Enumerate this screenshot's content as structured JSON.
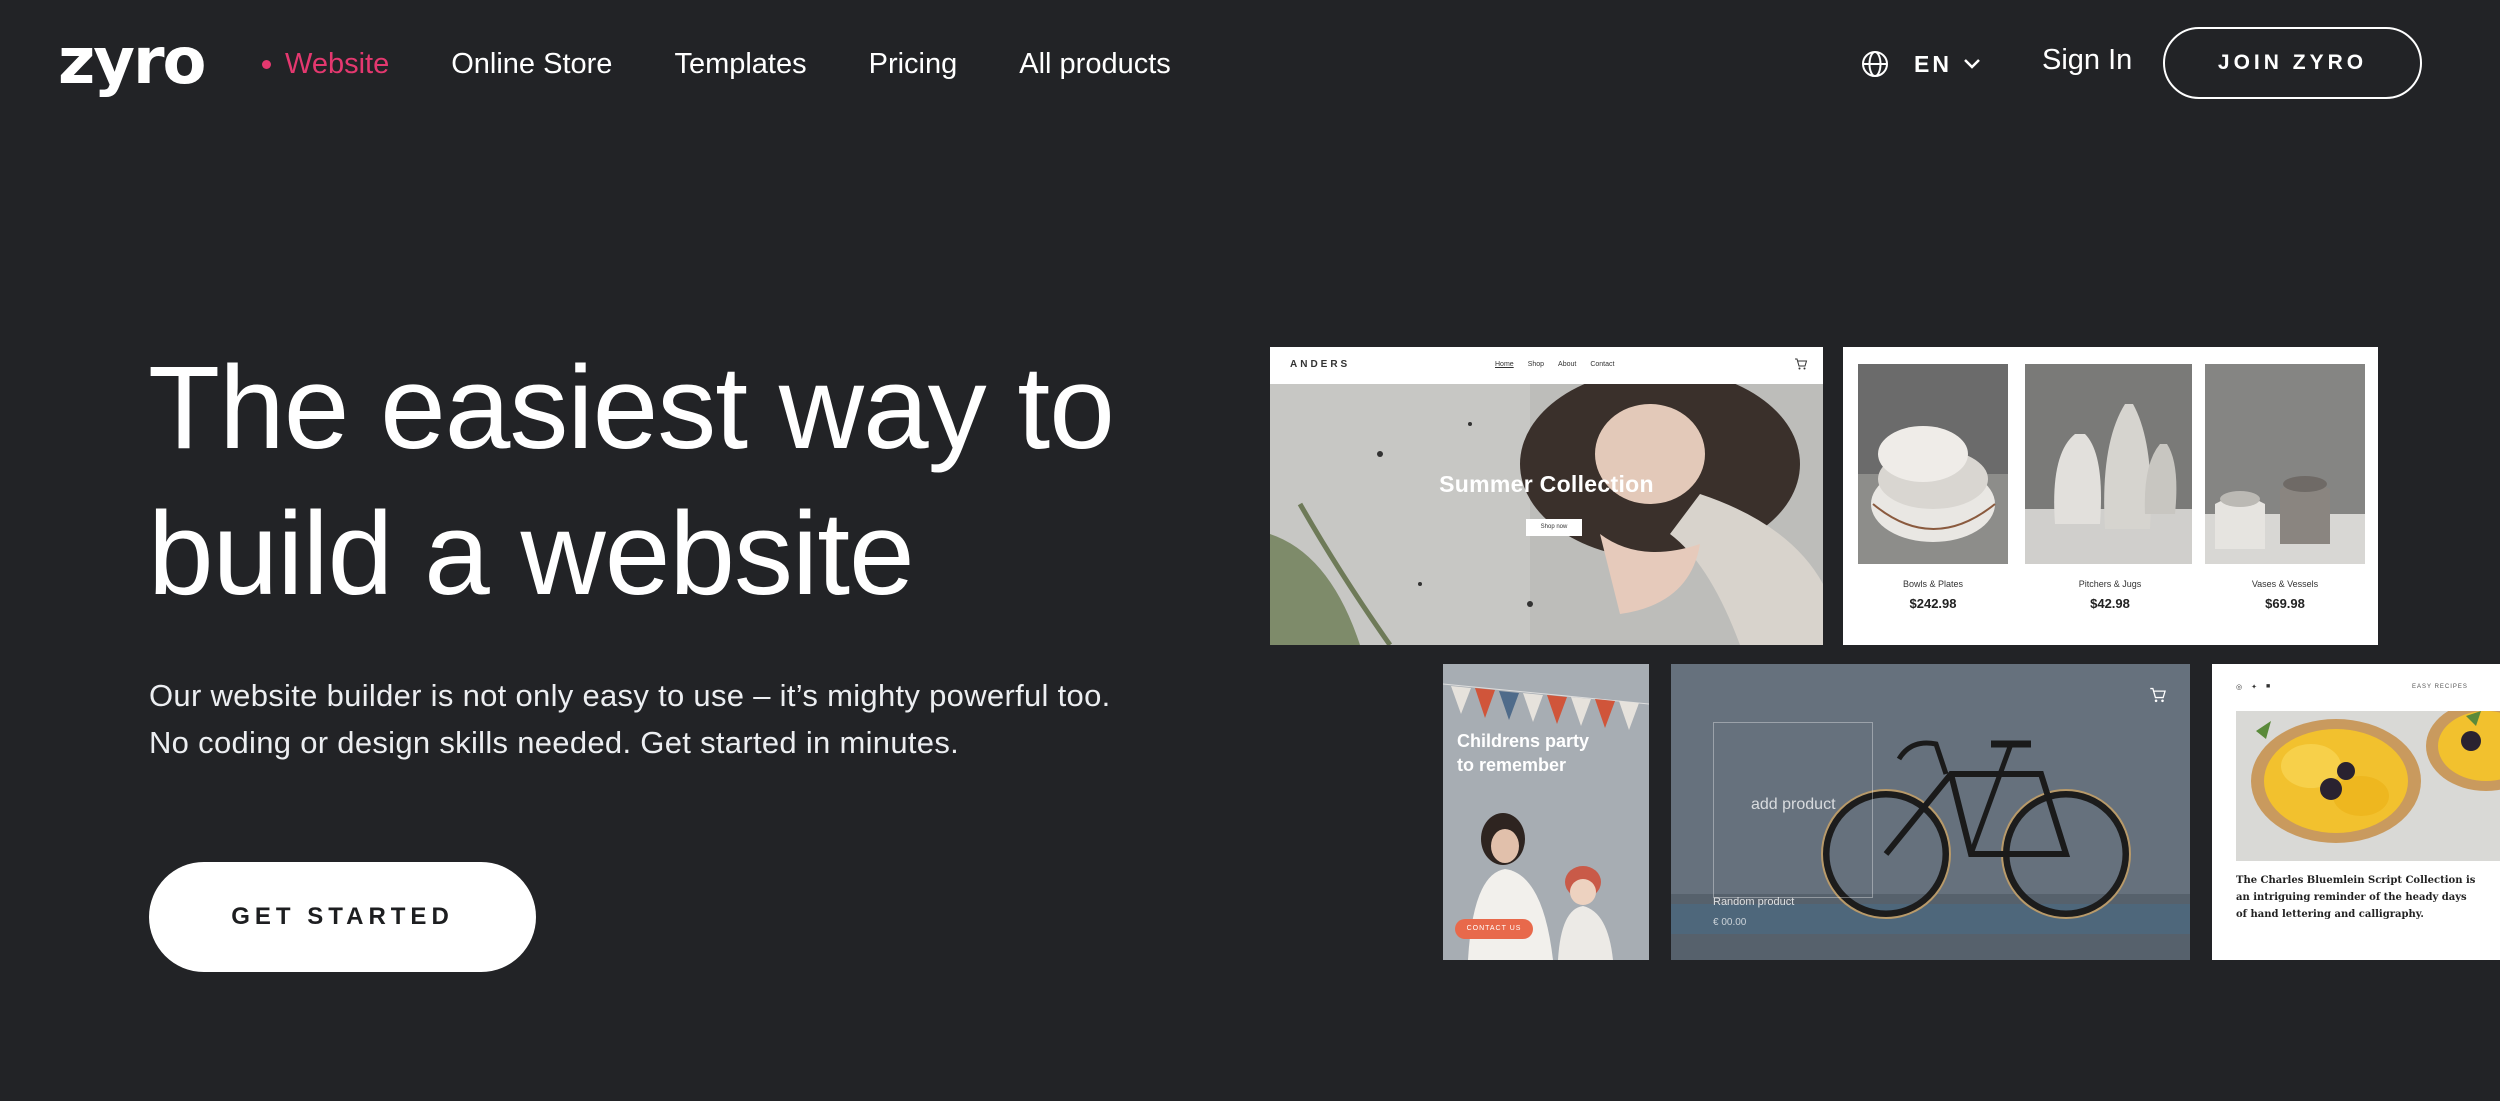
{
  "brand": {
    "logo_text": "zyro",
    "accent_color": "#e4386f",
    "background": "#222326"
  },
  "nav": {
    "links": [
      {
        "label": "Website",
        "active": true
      },
      {
        "label": "Online Store",
        "active": false
      },
      {
        "label": "Templates",
        "active": false
      },
      {
        "label": "Pricing",
        "active": false
      },
      {
        "label": "All products",
        "active": false
      }
    ],
    "language": {
      "icon": "globe-icon",
      "label": "EN",
      "dropdown_icon": "chevron-down-icon"
    },
    "signin_label": "Sign In",
    "join_label": "JOIN ZYRO"
  },
  "hero": {
    "title_line1": "The easiest way to",
    "title_line2": "build a website",
    "subtitle_line1": "Our website builder is not only easy to use – it’s mighty powerful too.",
    "subtitle_line2": "No coding or design skills needed. Get started in minutes.",
    "cta_label": "GET STARTED"
  },
  "templates": {
    "anders": {
      "logo": "ANDERS",
      "menu": [
        "Home",
        "Shop",
        "About",
        "Contact"
      ],
      "headline": "Summer Collection",
      "button": "Shop now"
    },
    "shop": {
      "products": [
        {
          "name": "Bowls & Plates",
          "price": "$242.98"
        },
        {
          "name": "Pitchers & Jugs",
          "price": "$42.98"
        },
        {
          "name": "Vases & Vessels",
          "price": "$69.98"
        }
      ]
    },
    "party": {
      "title_line1": "Childrens party",
      "title_line2": "to remember",
      "button": "CONTACT US"
    },
    "bike": {
      "add_product": "add product",
      "product_name": "Random product",
      "product_price": "€ 00.00"
    },
    "recipe": {
      "nav_text": "EASY RECIPES",
      "description": "The Charles Bluemlein Script Collection is an intriguing reminder of the heady days of hand lettering and calligraphy."
    }
  }
}
